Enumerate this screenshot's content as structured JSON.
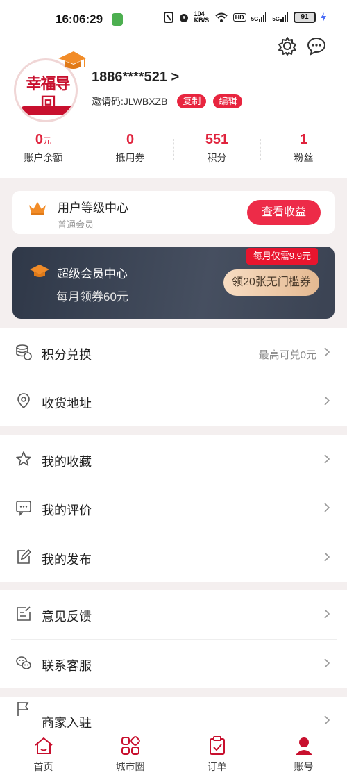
{
  "status_bar": {
    "time": "16:06:29",
    "network_speed": "104 KB/S",
    "hd_label": "HD",
    "signal_1": "5G",
    "signal_2": "5G",
    "battery": "91"
  },
  "header": {
    "phone": "1886****521 >",
    "invite_code": "邀请码:JLWBXZB",
    "copy_label": "复制",
    "edit_label": "编辑",
    "avatar_logo_text": "幸福导回",
    "stats": [
      {
        "value": "0",
        "unit": "元",
        "label": "账户余额"
      },
      {
        "value": "0",
        "unit": "",
        "label": "抵用券"
      },
      {
        "value": "551",
        "unit": "",
        "label": "积分"
      },
      {
        "value": "1",
        "unit": "",
        "label": "粉丝"
      }
    ]
  },
  "level_card": {
    "title": "用户等级中心",
    "subtitle": "普通会员",
    "button": "查看收益"
  },
  "vip_card": {
    "title": "超级会员中心",
    "subtitle": "每月领券60元",
    "tag": "每月仅需9.9元",
    "button": "领20张无门槛券"
  },
  "menu_groups": [
    [
      {
        "label": "积分兑换",
        "icon": "coins-icon",
        "extra": "最高可兑0元"
      },
      {
        "label": "收货地址",
        "icon": "location-pin-icon",
        "extra": ""
      }
    ],
    [
      {
        "label": "我的收藏",
        "icon": "star-icon",
        "extra": ""
      },
      {
        "label": "我的评价",
        "icon": "comment-icon",
        "extra": ""
      },
      {
        "label": "我的发布",
        "icon": "edit-note-icon",
        "extra": ""
      }
    ],
    [
      {
        "label": "意见反馈",
        "icon": "feedback-icon",
        "extra": ""
      },
      {
        "label": "联系客服",
        "icon": "wechat-icon",
        "extra": ""
      }
    ],
    [
      {
        "label": "商家入驻",
        "icon": "flag-icon",
        "extra": ""
      }
    ]
  ],
  "tabbar": [
    {
      "label": "首页",
      "icon": "home-icon"
    },
    {
      "label": "城市圈",
      "icon": "grid-icon"
    },
    {
      "label": "订单",
      "icon": "clipboard-icon"
    },
    {
      "label": "账号",
      "icon": "user-icon"
    }
  ],
  "colors": {
    "accent_red": "#e8253f",
    "vip_dark": "#2f3848",
    "gold": "#e4b991"
  }
}
